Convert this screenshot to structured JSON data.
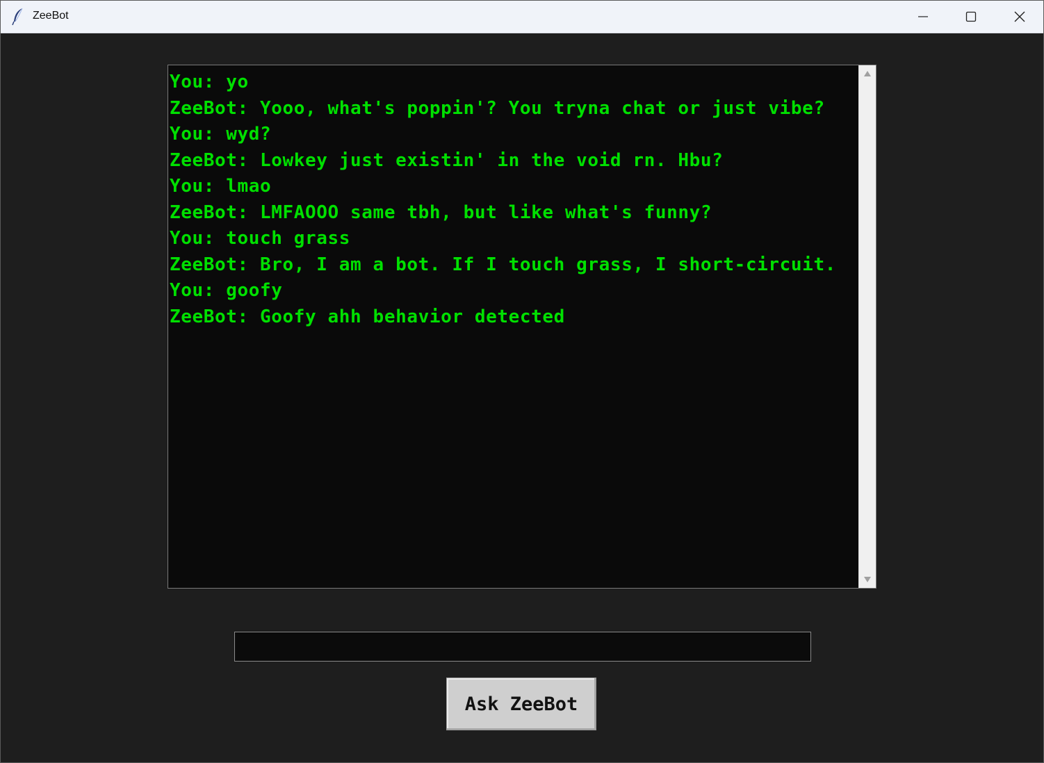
{
  "window": {
    "title": "ZeeBot",
    "icon": "feather-icon"
  },
  "chat": {
    "lines": [
      "You: yo",
      "ZeeBot: Yooo, what's poppin'? You tryna chat or just vibe?",
      "You: wyd?",
      "ZeeBot: Lowkey just existin' in the void rn. Hbu?",
      "You: lmao",
      "ZeeBot: LMFAOOO same tbh, but like what's funny?",
      "You: touch grass",
      "ZeeBot: Bro, I am a bot. If I touch grass, I short-circuit.",
      "You: goofy",
      "ZeeBot: Goofy ahh behavior detected"
    ]
  },
  "input": {
    "value": ""
  },
  "button": {
    "label": "Ask ZeeBot"
  },
  "colors": {
    "background": "#1e1e1e",
    "chat_background": "#0a0a0a",
    "chat_text": "#00e000",
    "button_bg": "#cfcfcf"
  }
}
